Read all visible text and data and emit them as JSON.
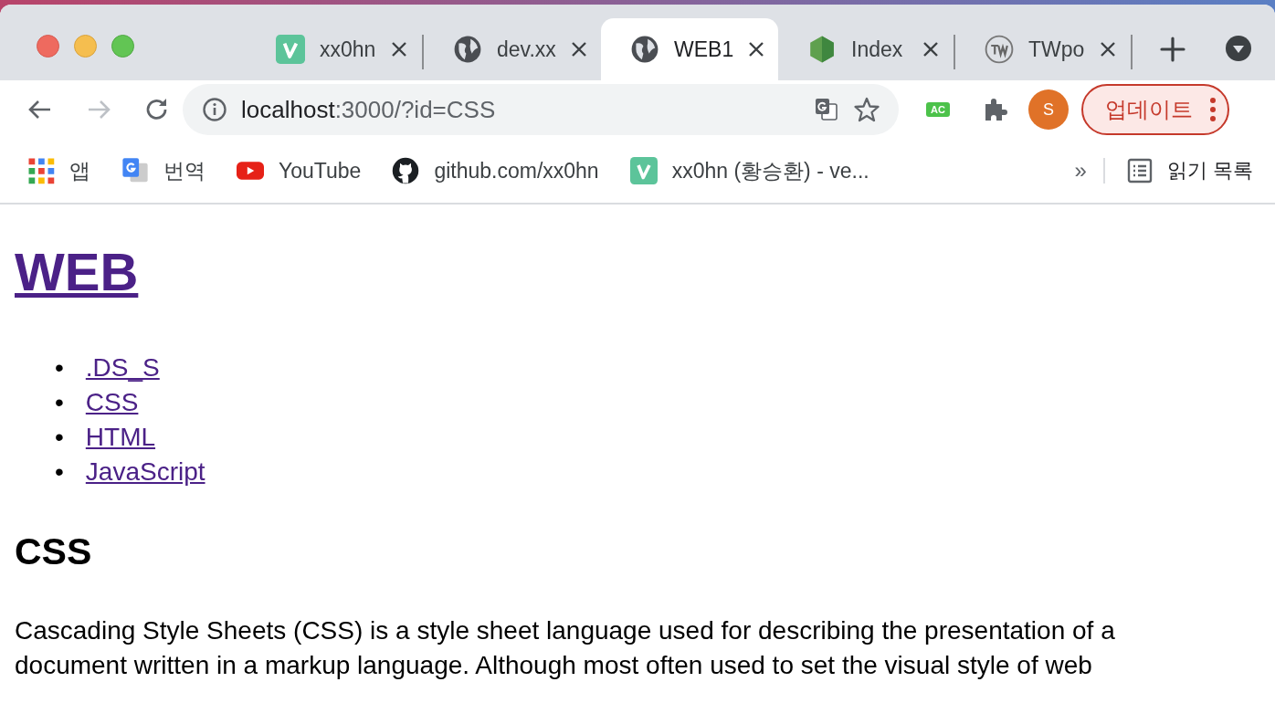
{
  "tabs": [
    {
      "title": "xx0hn",
      "selected": false
    },
    {
      "title": "dev.xx",
      "selected": false
    },
    {
      "title": "WEB1",
      "selected": true
    },
    {
      "title": "Index",
      "selected": false
    },
    {
      "title": "TWpo",
      "selected": false
    }
  ],
  "address_bar": {
    "host": "localhost",
    "path": ":3000/?id=CSS"
  },
  "toolbar": {
    "extension_badge": "AC",
    "avatar": "S",
    "update_button": "업데이트"
  },
  "bookmarks": [
    {
      "label": "앱"
    },
    {
      "label": "번역"
    },
    {
      "label": "YouTube"
    },
    {
      "label": "github.com/xx0hn"
    },
    {
      "label": "xx0hn (황승환) - ve..."
    }
  ],
  "bookmarks_overflow": "»",
  "reading_list": "읽기 목록",
  "page": {
    "heading": "WEB",
    "links": [
      {
        "marker": "•",
        "label": ".DS_S"
      },
      {
        "marker": "•",
        "label": "CSS"
      },
      {
        "marker": "•",
        "label": "HTML"
      },
      {
        "marker": "•",
        "label": "JavaScript"
      }
    ],
    "subheading": "CSS",
    "paragraph": "Cascading Style Sheets (CSS) is a style sheet language used for describing the presentation of a document written in a markup language. Although most often used to set the visual style of web"
  }
}
